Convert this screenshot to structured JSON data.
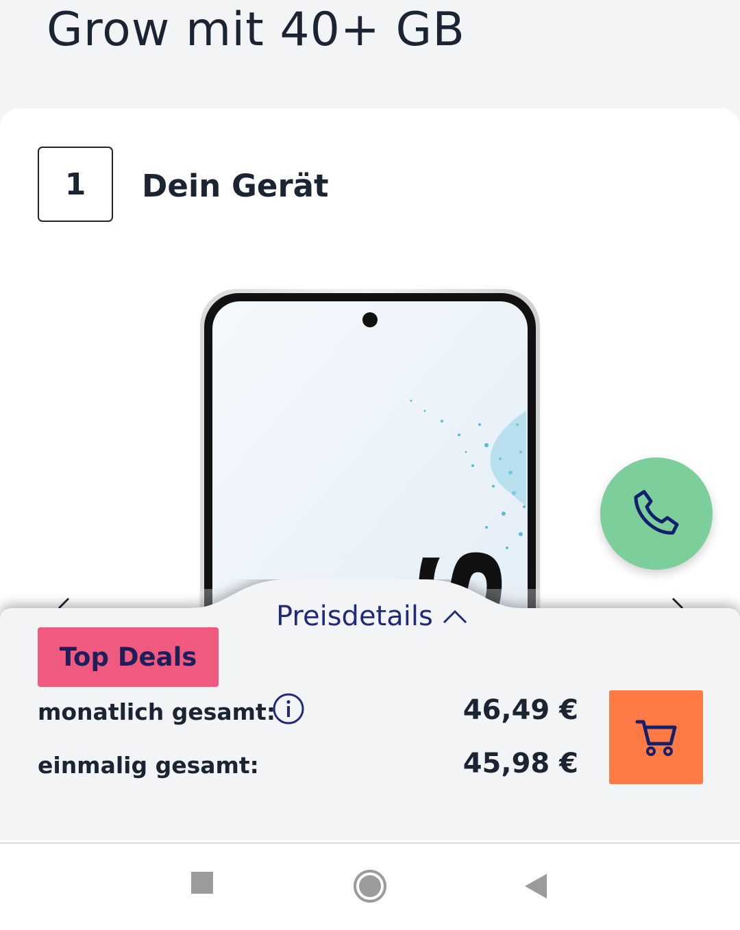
{
  "header": {
    "title": "Grow mit 40+ GB"
  },
  "step": {
    "number": "1",
    "title": "Dein Gerät"
  },
  "price_panel": {
    "details_label": "Preisdetails",
    "badge": "Top Deals",
    "monthly_label": "monatlich gesamt:",
    "monthly_value": "46,49 €",
    "once_label": "einmalig gesamt:",
    "once_value": "45,98 €"
  },
  "colors": {
    "primary_text": "#1b2433",
    "link_blue": "#1f2a7a",
    "badge_pink": "#f05a7e",
    "cart_orange": "#ff7a45",
    "call_green": "#7ccf9b"
  },
  "icons": {
    "call": "phone-icon",
    "cart": "cart-icon",
    "info": "info-icon",
    "expand": "chevron-up-icon",
    "prev": "chevron-left-icon",
    "next": "chevron-right-icon",
    "nav_recents": "square-icon",
    "nav_home": "circle-icon",
    "nav_back": "triangle-back-icon"
  }
}
